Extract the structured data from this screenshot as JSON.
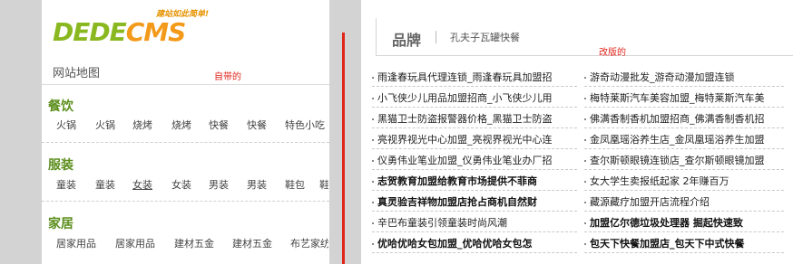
{
  "logo": {
    "part1": "DEDE",
    "part2": "CMS",
    "slogan": "建站如此简单!"
  },
  "left": {
    "title": "网站地图",
    "note": "自带的",
    "categories": [
      {
        "name": "餐饮",
        "items": [
          "火锅",
          "火锅",
          "烧烤",
          "烧烤",
          "快餐",
          "快餐",
          "特色小吃"
        ]
      },
      {
        "name": "服装",
        "items": [
          "童装",
          "童装",
          "女装",
          "女装",
          "男装",
          "男装",
          "鞋包",
          "鞋"
        ]
      },
      {
        "name": "家居",
        "items": [
          "居家用品",
          "居家用品",
          "建材五金",
          "建材五金",
          "布艺家纺"
        ]
      }
    ]
  },
  "right": {
    "note": "改版的",
    "brand_title": "品牌",
    "brand_link": "孔夫子瓦罐快餐",
    "left_column": [
      {
        "text": "雨逢春玩具代理连锁_雨逢春玩具加盟招",
        "bold": false
      },
      {
        "text": "小飞侠少儿用品加盟招商_小飞侠少儿用",
        "bold": false
      },
      {
        "text": "黑猫卫士防盗报警器价格_黑猫卫士防盗",
        "bold": false
      },
      {
        "text": "亮视界视光中心加盟_亮视界视光中心连",
        "bold": false
      },
      {
        "text": "仪勇伟业笔业加盟_仪勇伟业笔业办厂招",
        "bold": false
      },
      {
        "text": "志贺教育加盟给教育市场提供不菲商",
        "bold": true
      },
      {
        "text": "真灵验吉祥物加盟店抢占商机自然财",
        "bold": true
      },
      {
        "text": "辛巴布童装引领童装时尚风潮",
        "bold": false
      },
      {
        "text": "优哈优哈女包加盟_优哈优哈女包怎",
        "bold": true
      }
    ],
    "right_column": [
      {
        "text": "游奇动漫批发_游奇动漫加盟连锁",
        "bold": false
      },
      {
        "text": "梅特莱斯汽车美容加盟_梅特莱斯汽车美",
        "bold": false
      },
      {
        "text": "佛满香制香机加盟招商_佛满香制香机招",
        "bold": false
      },
      {
        "text": "金凤凰瑶浴养生店_金凤凰瑶浴养生加盟",
        "bold": false
      },
      {
        "text": "查尔斯顿眼镜连锁店_查尔斯顿眼镜加盟",
        "bold": false
      },
      {
        "text": "女大学生卖报纸起家 2年赚百万",
        "bold": false
      },
      {
        "text": "藏源藏疗加盟开店流程介绍",
        "bold": false
      },
      {
        "text": "加盟亿尔德垃圾处理器 掘起快速致",
        "bold": true
      },
      {
        "text": "包天下快餐加盟店_包天下中式快餐",
        "bold": true
      }
    ]
  },
  "colors": {
    "accent_green": "#5c8e1c",
    "logo_orange": "#f39a1a",
    "note_red": "#e0251b"
  }
}
